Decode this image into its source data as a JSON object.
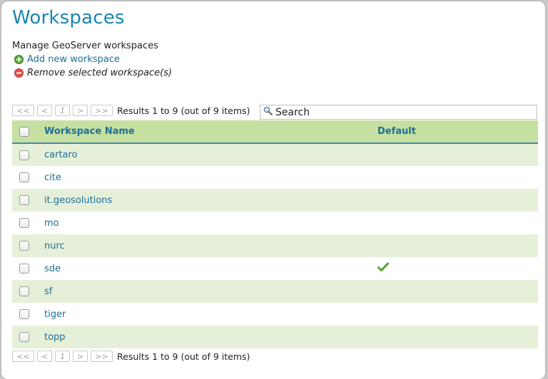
{
  "page": {
    "title": "Workspaces",
    "subtitle": "Manage GeoServer workspaces"
  },
  "actions": {
    "add_label": "Add new workspace",
    "remove_label": "Remove selected workspace(s)",
    "add_icon": "plus-circle-icon",
    "remove_icon": "minus-circle-icon"
  },
  "pager": {
    "first": "<<",
    "prev": "<",
    "current": "1",
    "next": ">",
    "last": ">>",
    "results_text": "Results 1 to 9 (out of 9 items)"
  },
  "search": {
    "placeholder": "Search",
    "value": "",
    "icon": "magnifier-icon"
  },
  "table": {
    "headers": {
      "name": "Workspace Name",
      "default": "Default"
    },
    "rows": [
      {
        "name": "cartaro",
        "default": false
      },
      {
        "name": "cite",
        "default": false
      },
      {
        "name": "it.geosolutions",
        "default": false
      },
      {
        "name": "mo",
        "default": false
      },
      {
        "name": "nurc",
        "default": false
      },
      {
        "name": "sde",
        "default": true
      },
      {
        "name": "sf",
        "default": false
      },
      {
        "name": "tiger",
        "default": false
      },
      {
        "name": "topp",
        "default": false
      }
    ]
  },
  "colors": {
    "title": "#1a86b0",
    "link": "#1d6f96",
    "header_bg": "#c6e0a2",
    "row_alt_bg": "#e6f0d9",
    "add_icon": "#5aa53a",
    "remove_icon": "#e0524a",
    "check": "#5a9e32"
  }
}
